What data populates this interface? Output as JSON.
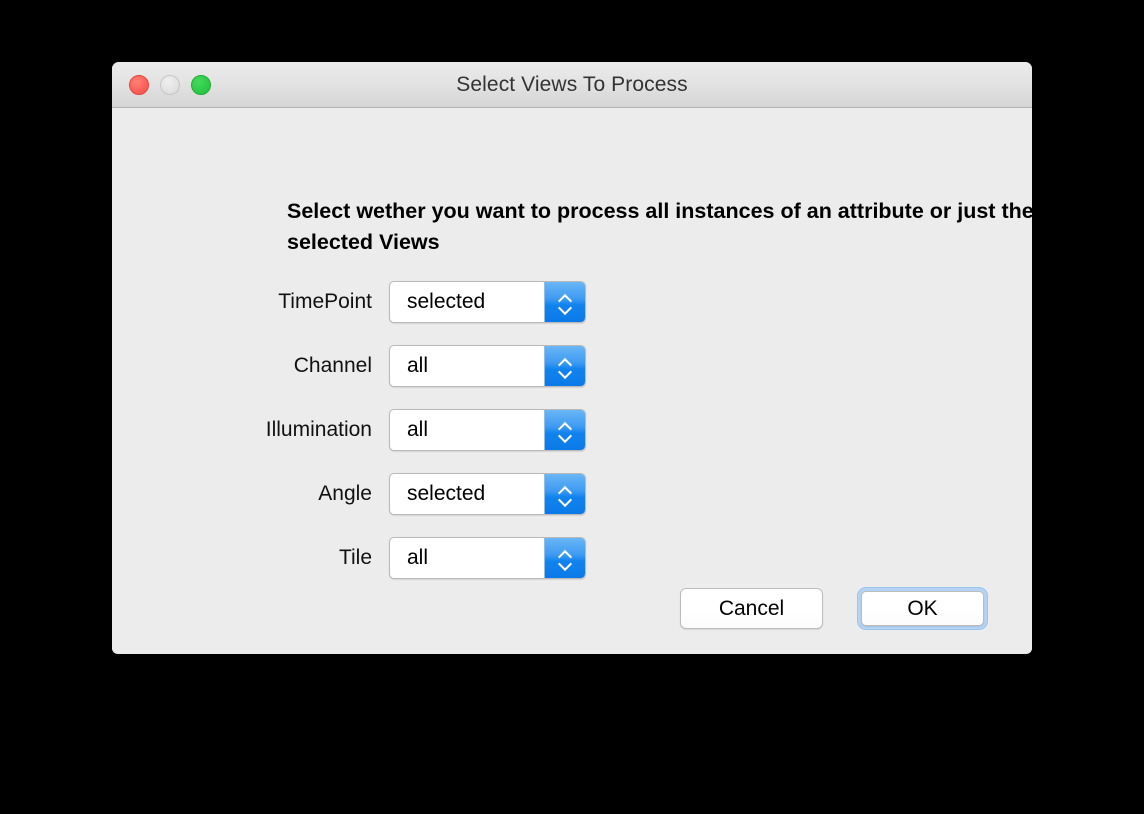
{
  "window": {
    "title": "Select Views To Process",
    "traffic_lights": [
      {
        "name": "close",
        "color": "#fb6159"
      },
      {
        "name": "minimize",
        "color": "#e2e2e2"
      },
      {
        "name": "zoom",
        "color": "#2ecb46"
      }
    ]
  },
  "dialog": {
    "heading": "Select wether you want to process all instances of an attribute or just the currently selected Views",
    "rows": [
      {
        "label": "TimePoint",
        "value": "selected"
      },
      {
        "label": "Channel",
        "value": "all"
      },
      {
        "label": "Illumination",
        "value": "all"
      },
      {
        "label": "Angle",
        "value": "selected"
      },
      {
        "label": "Tile",
        "value": "all"
      }
    ],
    "options": [
      "all",
      "selected"
    ],
    "buttons": {
      "cancel": "Cancel",
      "ok": "OK"
    }
  },
  "colors": {
    "window_background": "#ececec",
    "titlebar_top": "#ebebeb",
    "titlebar_bottom": "#d5d5d5",
    "stepper_blue": "#1183ef",
    "focus_ring": "#b5d3f2",
    "desktop": "#000000"
  }
}
